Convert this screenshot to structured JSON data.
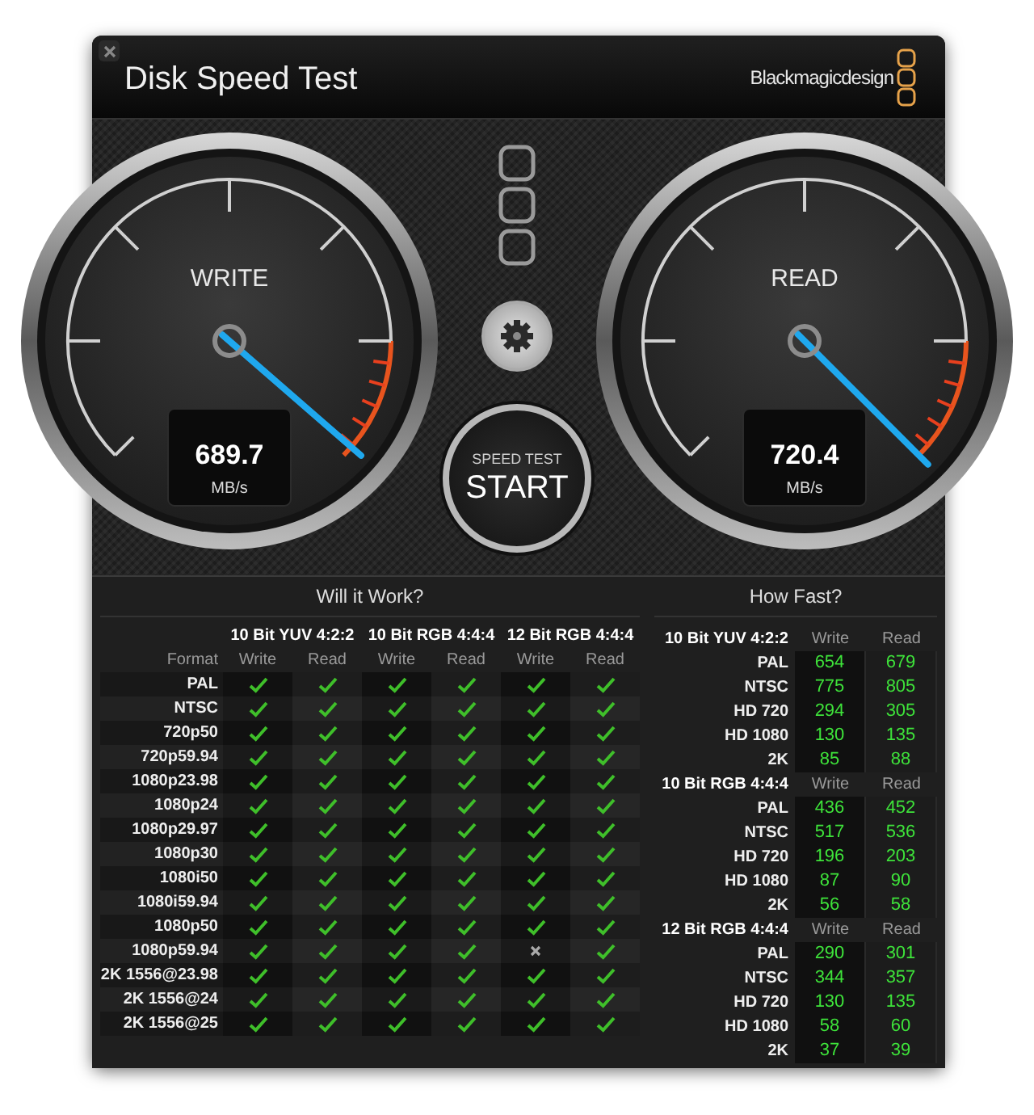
{
  "window": {
    "title": "Disk Speed Test",
    "brand": "Blackmagicdesign"
  },
  "gauges": [
    {
      "label": "WRITE",
      "value": "689.7",
      "unit": "MB/s"
    },
    {
      "label": "READ",
      "value": "720.4",
      "unit": "MB/s"
    }
  ],
  "start_button": {
    "caption": "SPEED TEST",
    "label": "START"
  },
  "will_it_work": {
    "title": "Will it Work?",
    "format_label": "Format",
    "groups": [
      {
        "name": "10 Bit YUV 4:2:2",
        "columns": [
          "Write",
          "Read"
        ]
      },
      {
        "name": "10 Bit RGB 4:4:4",
        "columns": [
          "Write",
          "Read"
        ]
      },
      {
        "name": "12 Bit RGB 4:4:4",
        "columns": [
          "Write",
          "Read"
        ]
      }
    ],
    "rows": [
      {
        "format": "PAL",
        "results": [
          true,
          true,
          true,
          true,
          true,
          true
        ]
      },
      {
        "format": "NTSC",
        "results": [
          true,
          true,
          true,
          true,
          true,
          true
        ]
      },
      {
        "format": "720p50",
        "results": [
          true,
          true,
          true,
          true,
          true,
          true
        ]
      },
      {
        "format": "720p59.94",
        "results": [
          true,
          true,
          true,
          true,
          true,
          true
        ]
      },
      {
        "format": "1080p23.98",
        "results": [
          true,
          true,
          true,
          true,
          true,
          true
        ]
      },
      {
        "format": "1080p24",
        "results": [
          true,
          true,
          true,
          true,
          true,
          true
        ]
      },
      {
        "format": "1080p29.97",
        "results": [
          true,
          true,
          true,
          true,
          true,
          true
        ]
      },
      {
        "format": "1080p30",
        "results": [
          true,
          true,
          true,
          true,
          true,
          true
        ]
      },
      {
        "format": "1080i50",
        "results": [
          true,
          true,
          true,
          true,
          true,
          true
        ]
      },
      {
        "format": "1080i59.94",
        "results": [
          true,
          true,
          true,
          true,
          true,
          true
        ]
      },
      {
        "format": "1080p50",
        "results": [
          true,
          true,
          true,
          true,
          true,
          true
        ]
      },
      {
        "format": "1080p59.94",
        "results": [
          true,
          true,
          true,
          true,
          false,
          true
        ]
      },
      {
        "format": "2K 1556@23.98",
        "results": [
          true,
          true,
          true,
          true,
          true,
          true
        ]
      },
      {
        "format": "2K 1556@24",
        "results": [
          true,
          true,
          true,
          true,
          true,
          true
        ]
      },
      {
        "format": "2K 1556@25",
        "results": [
          true,
          true,
          true,
          true,
          true,
          true
        ]
      }
    ]
  },
  "how_fast": {
    "title": "How Fast?",
    "groups": [
      {
        "name": "10 Bit YUV 4:2:2",
        "columns": [
          "Write",
          "Read"
        ],
        "rows": [
          {
            "format": "PAL",
            "write": "654",
            "read": "679"
          },
          {
            "format": "NTSC",
            "write": "775",
            "read": "805"
          },
          {
            "format": "HD 720",
            "write": "294",
            "read": "305"
          },
          {
            "format": "HD 1080",
            "write": "130",
            "read": "135"
          },
          {
            "format": "2K",
            "write": "85",
            "read": "88"
          }
        ]
      },
      {
        "name": "10 Bit RGB 4:4:4",
        "columns": [
          "Write",
          "Read"
        ],
        "rows": [
          {
            "format": "PAL",
            "write": "436",
            "read": "452"
          },
          {
            "format": "NTSC",
            "write": "517",
            "read": "536"
          },
          {
            "format": "HD 720",
            "write": "196",
            "read": "203"
          },
          {
            "format": "HD 1080",
            "write": "87",
            "read": "90"
          },
          {
            "format": "2K",
            "write": "56",
            "read": "58"
          }
        ]
      },
      {
        "name": "12 Bit RGB 4:4:4",
        "columns": [
          "Write",
          "Read"
        ],
        "rows": [
          {
            "format": "PAL",
            "write": "290",
            "read": "301"
          },
          {
            "format": "NTSC",
            "write": "344",
            "read": "357"
          },
          {
            "format": "HD 720",
            "write": "130",
            "read": "135"
          },
          {
            "format": "HD 1080",
            "write": "58",
            "read": "60"
          },
          {
            "format": "2K",
            "write": "37",
            "read": "39"
          }
        ]
      }
    ]
  }
}
